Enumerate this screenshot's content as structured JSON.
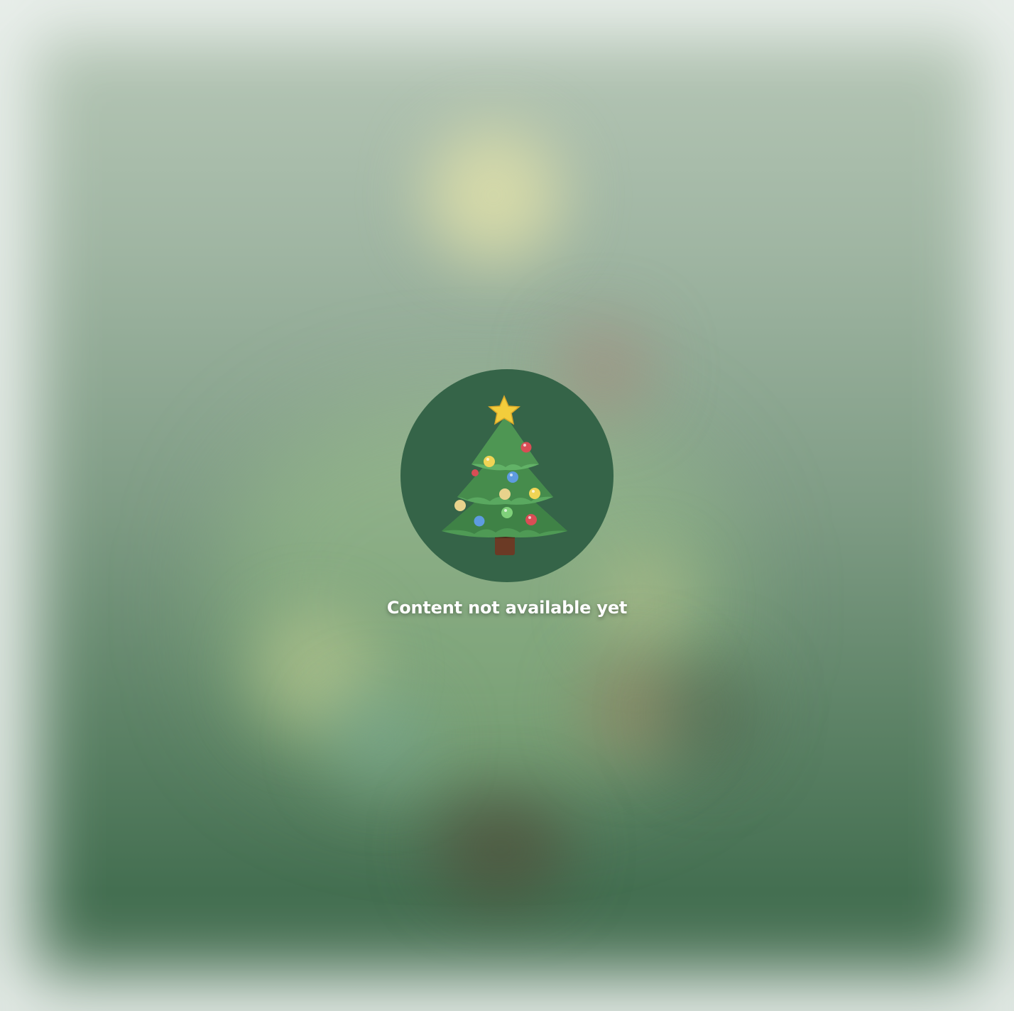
{
  "placeholder": {
    "icon": "christmas-tree-icon",
    "message": "Content not available yet",
    "circle_color": "#356448",
    "text_color": "#ffffff"
  }
}
